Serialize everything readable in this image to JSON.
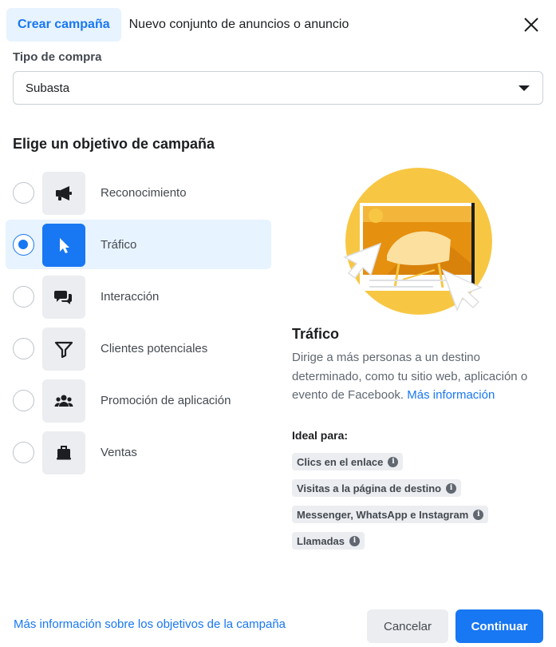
{
  "tabs": {
    "create_campaign": "Crear campaña",
    "new_adset": "Nuevo conjunto de anuncios o anuncio"
  },
  "buy_type": {
    "label": "Tipo de compra",
    "value": "Subasta"
  },
  "objective_title": "Elige un objetivo de campaña",
  "objectives": [
    {
      "label": "Reconocimiento",
      "icon": "megaphone-icon",
      "selected": false
    },
    {
      "label": "Tráfico",
      "icon": "cursor-icon",
      "selected": true
    },
    {
      "label": "Interacción",
      "icon": "chat-bubbles-icon",
      "selected": false
    },
    {
      "label": "Clientes potenciales",
      "icon": "funnel-icon",
      "selected": false
    },
    {
      "label": "Promoción de aplicación",
      "icon": "people-icon",
      "selected": false
    },
    {
      "label": "Ventas",
      "icon": "briefcase-icon",
      "selected": false
    }
  ],
  "detail": {
    "title": "Tráfico",
    "description": "Dirige a más personas a un destino determinado, como tu sitio web, aplicación o evento de Facebook.",
    "more_link": "Más información",
    "ideal_label": "Ideal para:",
    "chips": [
      "Clics en el enlace",
      "Visitas a la página de destino",
      "Messenger, WhatsApp e Instagram",
      "Llamadas"
    ]
  },
  "footer": {
    "learn_more": "Más información sobre los objetivos de la campaña",
    "cancel": "Cancelar",
    "continue": "Continuar"
  },
  "colors": {
    "accent": "#1877f2",
    "selected_bg": "#e7f3ff",
    "illustration_yellow": "#f7c744",
    "illustration_orange": "#e5900f"
  }
}
